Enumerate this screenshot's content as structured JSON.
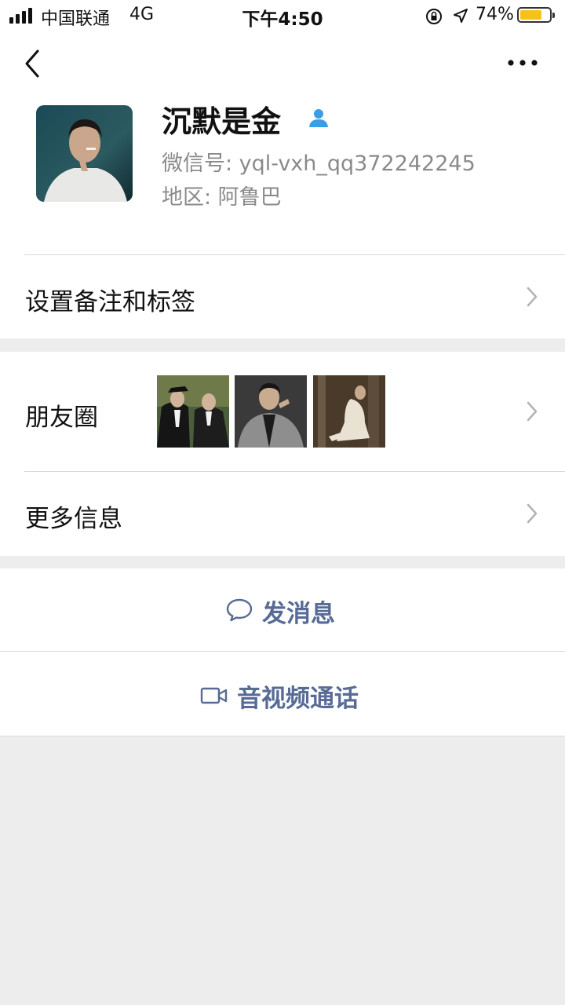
{
  "status_bar": {
    "carrier": "中国联通",
    "network": "4G",
    "time": "下午4:50",
    "battery_percent": "74%",
    "battery_level": 0.74,
    "battery_color": "#f6c218"
  },
  "nav": {
    "back_icon": "chevron-left-icon",
    "more_icon": "more-dots-icon"
  },
  "profile": {
    "name": "沉默是金",
    "friend_icon": "person-icon",
    "friend_icon_color": "#3a9ee6",
    "wechat_id": "微信号:  yql-vxh_qq372242245",
    "region": "地区:  阿鲁巴"
  },
  "rows": {
    "remark_label": "设置备注和标签",
    "moments_label": "朋友圈",
    "more_info_label": "更多信息"
  },
  "actions": {
    "message_label": "发消息",
    "message_icon": "chat-bubble-icon",
    "call_label": "音视频通话",
    "call_icon": "video-camera-icon",
    "accent_color": "#576b95"
  }
}
